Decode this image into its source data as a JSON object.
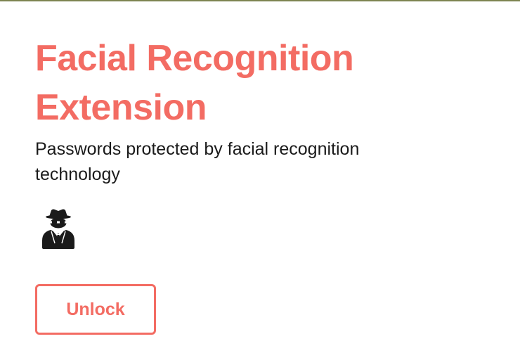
{
  "header": {
    "title": "Facial Recognition Extension",
    "subtitle": "Passwords protected by facial recognition technology"
  },
  "icon": {
    "name": "user-secret-icon"
  },
  "actions": {
    "unlock_label": "Unlock"
  },
  "colors": {
    "accent": "#f36c63",
    "text": "#1b1b1b",
    "top_rule": "#7d8451",
    "background": "#ffffff"
  }
}
